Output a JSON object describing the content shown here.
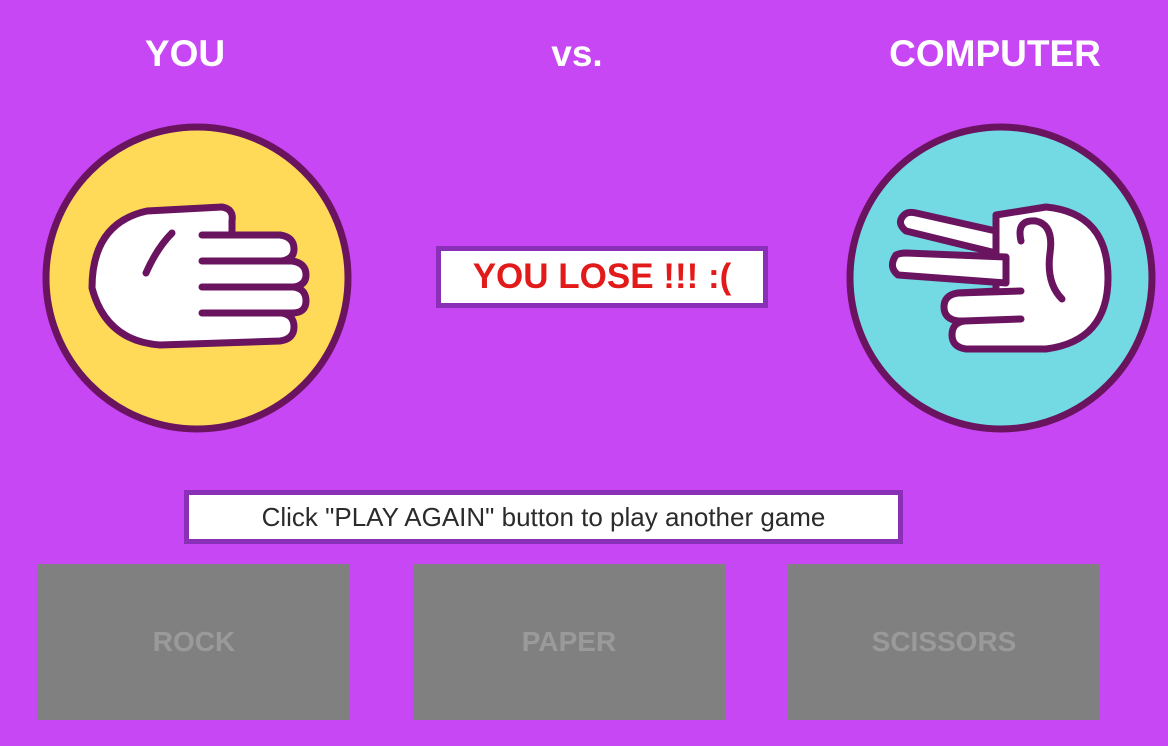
{
  "header": {
    "player_label": "YOU",
    "versus_label": "vs.",
    "computer_label": "COMPUTER"
  },
  "player": {
    "choice": "rock",
    "icon": "rock-hand-icon",
    "circle_color": "#ffda59"
  },
  "computer": {
    "choice": "scissors",
    "icon": "scissors-hand-icon",
    "circle_color": "#73d9e2"
  },
  "result": {
    "text": "YOU LOSE !!! :(",
    "color": "#e21a1a"
  },
  "hint": {
    "text": "Click \"PLAY AGAIN\" button to play another game"
  },
  "choices": {
    "rock_label": "ROCK",
    "paper_label": "PAPER",
    "scissors_label": "SCISSORS",
    "state": "disabled"
  },
  "colors": {
    "background": "#c847f5",
    "outline": "#6a1460",
    "box_border": "#8a2fb8",
    "button_bg": "#808080",
    "button_text": "#9a9a9a"
  }
}
